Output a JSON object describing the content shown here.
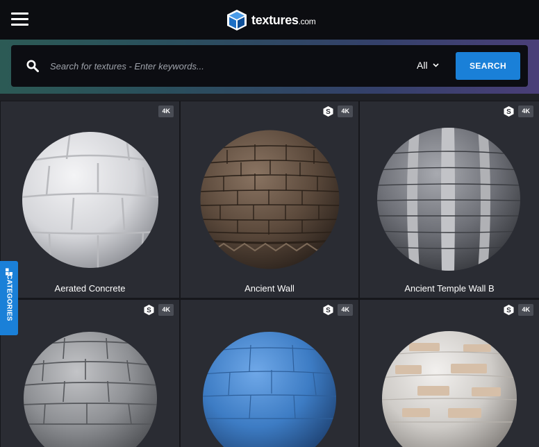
{
  "header": {
    "logo_text": "textures",
    "logo_suffix": ".com"
  },
  "search": {
    "placeholder": "Search for textures - Enter keywords...",
    "value": "",
    "scope": "All",
    "button_label": "SEARCH"
  },
  "sidebar": {
    "categories_label": "CATEGORIES"
  },
  "textures": [
    {
      "title": "Aerated Concrete",
      "resolution": "4K",
      "substance": false
    },
    {
      "title": "Ancient Wall",
      "resolution": "4K",
      "substance": true
    },
    {
      "title": "Ancient Temple Wall B",
      "resolution": "4K",
      "substance": true
    },
    {
      "title": "",
      "resolution": "4K",
      "substance": true
    },
    {
      "title": "",
      "resolution": "4K",
      "substance": true
    },
    {
      "title": "",
      "resolution": "4K",
      "substance": true
    }
  ],
  "colors": {
    "accent": "#1a80d8",
    "topbar": "#0c0d11",
    "card": "#2a2c33"
  }
}
